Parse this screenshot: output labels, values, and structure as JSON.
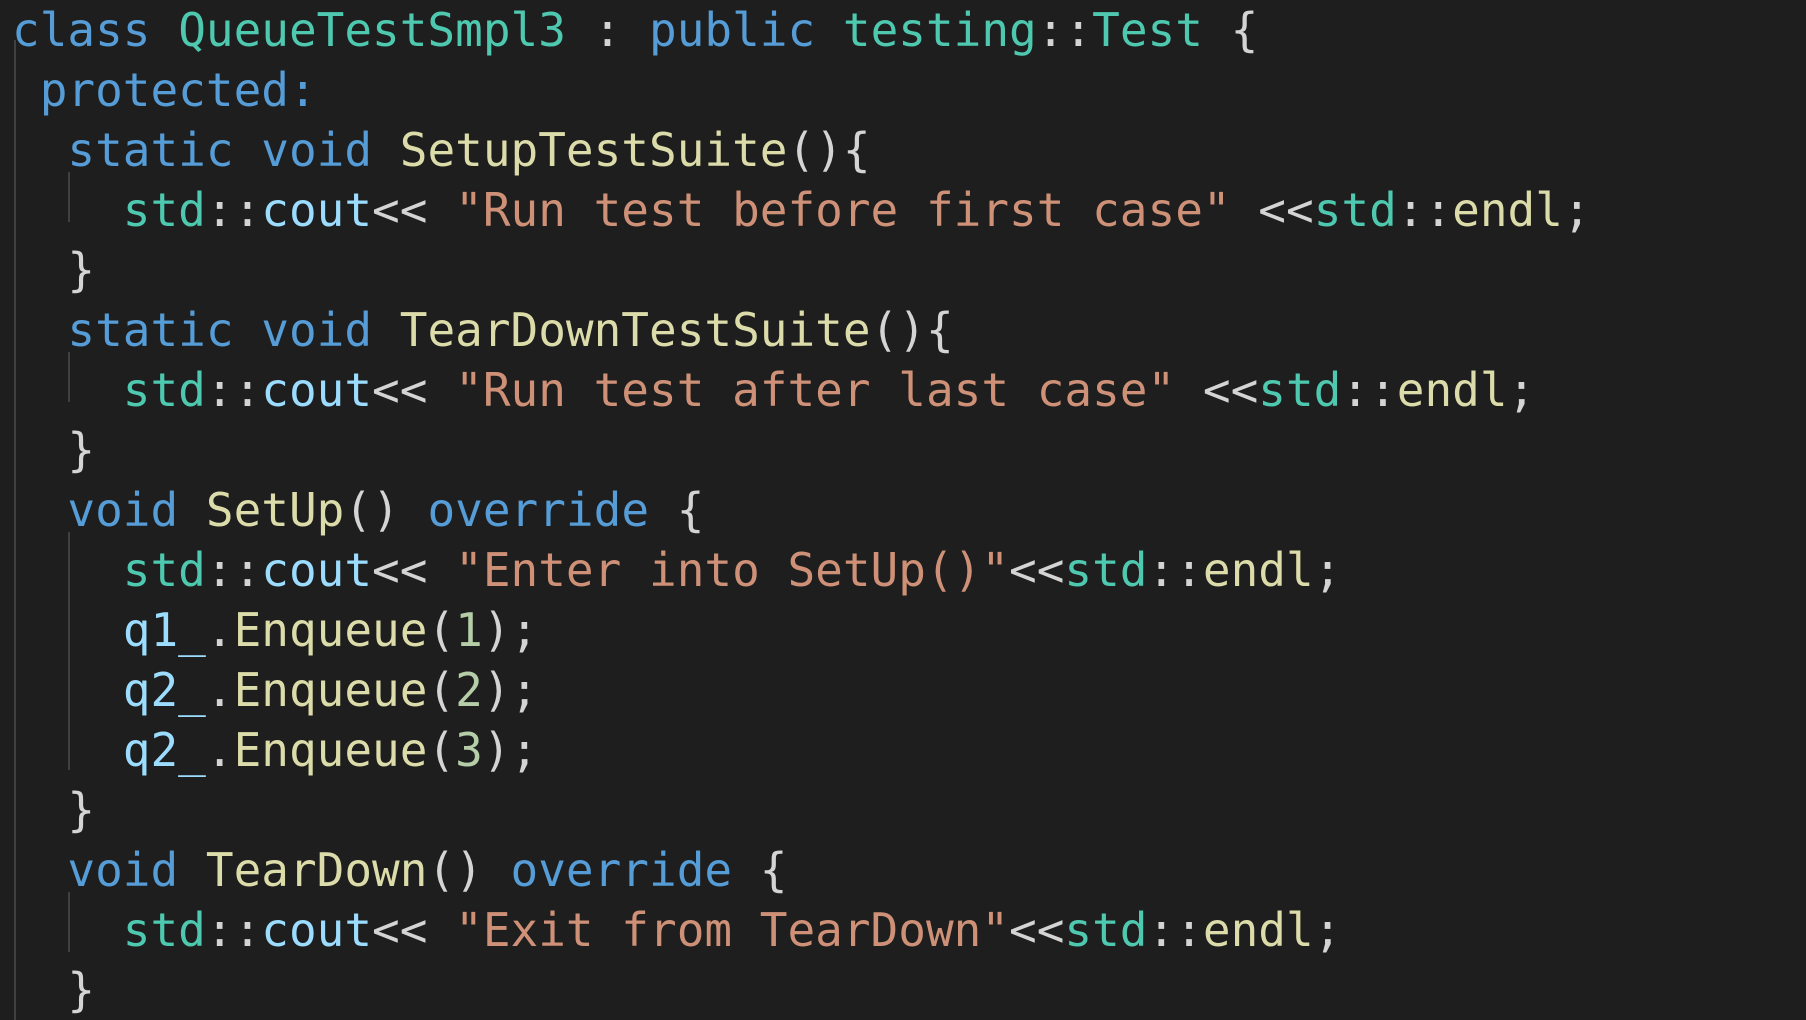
{
  "editor": {
    "colors": {
      "background": "#1e1e1e",
      "keyword": "#569cd6",
      "type": "#4ec9b0",
      "function": "#dcdcaa",
      "string": "#ce9178",
      "variable": "#9cdcfe",
      "number": "#b5cea8",
      "punctuation": "#d4d4d4",
      "indent_guide": "#404040"
    },
    "lines": [
      [
        {
          "t": "kw",
          "v": "class"
        },
        {
          "t": "pun",
          "v": " "
        },
        {
          "t": "ty",
          "v": "QueueTestSmpl3"
        },
        {
          "t": "pun",
          "v": " : "
        },
        {
          "t": "kw",
          "v": "public"
        },
        {
          "t": "pun",
          "v": " "
        },
        {
          "t": "ty",
          "v": "testing"
        },
        {
          "t": "pun",
          "v": "::"
        },
        {
          "t": "ty",
          "v": "Test"
        },
        {
          "t": "pun",
          "v": " {"
        }
      ],
      [
        {
          "t": "pun",
          "v": " "
        },
        {
          "t": "kw",
          "v": "protected:"
        }
      ],
      [
        {
          "t": "pun",
          "v": "  "
        },
        {
          "t": "kw",
          "v": "static"
        },
        {
          "t": "pun",
          "v": " "
        },
        {
          "t": "kw",
          "v": "void"
        },
        {
          "t": "pun",
          "v": " "
        },
        {
          "t": "fn",
          "v": "SetupTestSuite"
        },
        {
          "t": "pun",
          "v": "(){"
        }
      ],
      [
        {
          "t": "pun",
          "v": "    "
        },
        {
          "t": "ty",
          "v": "std"
        },
        {
          "t": "pun",
          "v": "::"
        },
        {
          "t": "var",
          "v": "cout"
        },
        {
          "t": "pun",
          "v": "<< "
        },
        {
          "t": "str",
          "v": "\"Run test before first case\""
        },
        {
          "t": "pun",
          "v": " <<"
        },
        {
          "t": "ty",
          "v": "std"
        },
        {
          "t": "pun",
          "v": "::"
        },
        {
          "t": "fn",
          "v": "endl"
        },
        {
          "t": "pun",
          "v": ";"
        }
      ],
      [
        {
          "t": "pun",
          "v": "  }"
        }
      ],
      [
        {
          "t": "pun",
          "v": "  "
        },
        {
          "t": "kw",
          "v": "static"
        },
        {
          "t": "pun",
          "v": " "
        },
        {
          "t": "kw",
          "v": "void"
        },
        {
          "t": "pun",
          "v": " "
        },
        {
          "t": "fn",
          "v": "TearDownTestSuite"
        },
        {
          "t": "pun",
          "v": "(){"
        }
      ],
      [
        {
          "t": "pun",
          "v": "    "
        },
        {
          "t": "ty",
          "v": "std"
        },
        {
          "t": "pun",
          "v": "::"
        },
        {
          "t": "var",
          "v": "cout"
        },
        {
          "t": "pun",
          "v": "<< "
        },
        {
          "t": "str",
          "v": "\"Run test after last case\""
        },
        {
          "t": "pun",
          "v": " <<"
        },
        {
          "t": "ty",
          "v": "std"
        },
        {
          "t": "pun",
          "v": "::"
        },
        {
          "t": "fn",
          "v": "endl"
        },
        {
          "t": "pun",
          "v": ";"
        }
      ],
      [
        {
          "t": "pun",
          "v": "  }"
        }
      ],
      [
        {
          "t": "pun",
          "v": "  "
        },
        {
          "t": "kw",
          "v": "void"
        },
        {
          "t": "pun",
          "v": " "
        },
        {
          "t": "fn",
          "v": "SetUp"
        },
        {
          "t": "pun",
          "v": "() "
        },
        {
          "t": "kw",
          "v": "override"
        },
        {
          "t": "pun",
          "v": " {"
        }
      ],
      [
        {
          "t": "pun",
          "v": "    "
        },
        {
          "t": "ty",
          "v": "std"
        },
        {
          "t": "pun",
          "v": "::"
        },
        {
          "t": "var",
          "v": "cout"
        },
        {
          "t": "pun",
          "v": "<< "
        },
        {
          "t": "str",
          "v": "\"Enter into SetUp()\""
        },
        {
          "t": "pun",
          "v": "<<"
        },
        {
          "t": "ty",
          "v": "std"
        },
        {
          "t": "pun",
          "v": "::"
        },
        {
          "t": "fn",
          "v": "endl"
        },
        {
          "t": "pun",
          "v": ";"
        }
      ],
      [
        {
          "t": "pun",
          "v": "    "
        },
        {
          "t": "var",
          "v": "q1_"
        },
        {
          "t": "pun",
          "v": "."
        },
        {
          "t": "fn",
          "v": "Enqueue"
        },
        {
          "t": "pun",
          "v": "("
        },
        {
          "t": "num",
          "v": "1"
        },
        {
          "t": "pun",
          "v": ");"
        }
      ],
      [
        {
          "t": "pun",
          "v": "    "
        },
        {
          "t": "var",
          "v": "q2_"
        },
        {
          "t": "pun",
          "v": "."
        },
        {
          "t": "fn",
          "v": "Enqueue"
        },
        {
          "t": "pun",
          "v": "("
        },
        {
          "t": "num",
          "v": "2"
        },
        {
          "t": "pun",
          "v": ");"
        }
      ],
      [
        {
          "t": "pun",
          "v": "    "
        },
        {
          "t": "var",
          "v": "q2_"
        },
        {
          "t": "pun",
          "v": "."
        },
        {
          "t": "fn",
          "v": "Enqueue"
        },
        {
          "t": "pun",
          "v": "("
        },
        {
          "t": "num",
          "v": "3"
        },
        {
          "t": "pun",
          "v": ");"
        }
      ],
      [
        {
          "t": "pun",
          "v": "  }"
        }
      ],
      [
        {
          "t": "pun",
          "v": "  "
        },
        {
          "t": "kw",
          "v": "void"
        },
        {
          "t": "pun",
          "v": " "
        },
        {
          "t": "fn",
          "v": "TearDown"
        },
        {
          "t": "pun",
          "v": "() "
        },
        {
          "t": "kw",
          "v": "override"
        },
        {
          "t": "pun",
          "v": " {"
        }
      ],
      [
        {
          "t": "pun",
          "v": "    "
        },
        {
          "t": "ty",
          "v": "std"
        },
        {
          "t": "pun",
          "v": "::"
        },
        {
          "t": "var",
          "v": "cout"
        },
        {
          "t": "pun",
          "v": "<< "
        },
        {
          "t": "str",
          "v": "\"Exit from TearDown\""
        },
        {
          "t": "pun",
          "v": "<<"
        },
        {
          "t": "ty",
          "v": "std"
        },
        {
          "t": "pun",
          "v": "::"
        },
        {
          "t": "fn",
          "v": "endl"
        },
        {
          "t": "pun",
          "v": ";"
        }
      ],
      [
        {
          "t": "pun",
          "v": "  }"
        }
      ]
    ]
  }
}
